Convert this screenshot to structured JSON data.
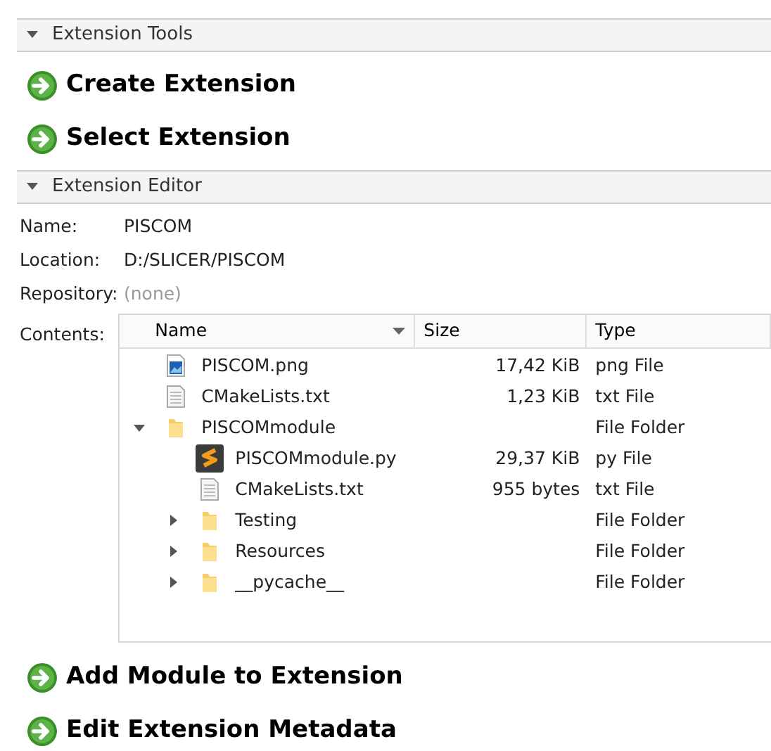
{
  "sections": [
    {
      "title": "Extension Tools",
      "expanded": true,
      "actions": [
        "Create Extension",
        "Select Extension"
      ]
    },
    {
      "title": "Extension Editor",
      "expanded": true,
      "fields": [
        {
          "label": "Name:",
          "value": "PISCOM",
          "kind": "text"
        },
        {
          "label": "Location:",
          "value": "D:/SLICER/PISCOM",
          "kind": "text"
        },
        {
          "label": "Repository:",
          "value": "(none)",
          "kind": "empty"
        }
      ],
      "contents_label": "Contents:",
      "table": {
        "columns": [
          "Name",
          "Size",
          "Type"
        ],
        "rows": [
          {
            "name": "PISCOM.png",
            "kind": "image",
            "size": "17,42 KiB",
            "type": "png File"
          },
          {
            "name": "CMakeLists.txt",
            "kind": "text",
            "size": "1,23 KiB",
            "type": "txt File"
          },
          {
            "name": "PISCOMmodule",
            "kind": "folder",
            "type": "File Folder",
            "expanded": true,
            "children": [
              {
                "name": "PISCOMmodule.py",
                "kind": "script",
                "size": "29,37 KiB",
                "type": "py File"
              },
              {
                "name": "CMakeLists.txt",
                "kind": "text",
                "size": "955 bytes",
                "type": "txt File"
              },
              {
                "name": "Testing",
                "kind": "folder",
                "type": "File Folder",
                "expanded": false
              },
              {
                "name": "Resources",
                "kind": "folder",
                "type": "File Folder",
                "expanded": false
              },
              {
                "name": "__pycache__",
                "kind": "folder",
                "type": "File Folder",
                "expanded": false
              }
            ]
          }
        ]
      },
      "actions": [
        "Add Module to Extension",
        "Edit Extension Metadata"
      ]
    }
  ]
}
